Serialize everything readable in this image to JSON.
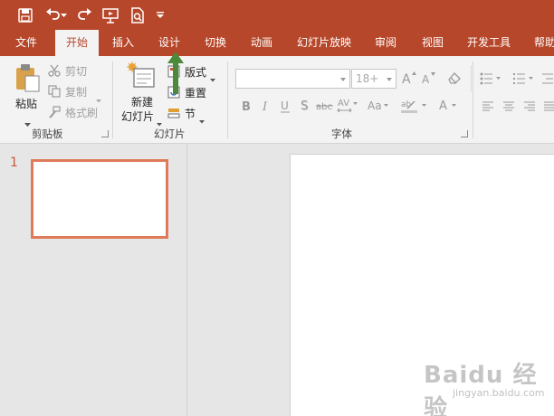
{
  "qat": {
    "items": [
      {
        "icon": "save-icon"
      },
      {
        "icon": "undo-icon"
      },
      {
        "icon": "redo-icon"
      },
      {
        "icon": "start-from-beginning-icon"
      },
      {
        "icon": "print-preview-icon"
      },
      {
        "icon": "customize-dropdown-icon"
      }
    ]
  },
  "tabs": [
    {
      "label": "文件"
    },
    {
      "label": "开始",
      "active": true
    },
    {
      "label": "插入"
    },
    {
      "label": "设计"
    },
    {
      "label": "切换"
    },
    {
      "label": "动画"
    },
    {
      "label": "幻灯片放映"
    },
    {
      "label": "审阅"
    },
    {
      "label": "视图"
    },
    {
      "label": "开发工具"
    },
    {
      "label": "帮助"
    }
  ],
  "clipboard": {
    "paste": "粘贴",
    "cut": "剪切",
    "copy": "复制",
    "format_painter": "格式刷",
    "group_label": "剪贴板"
  },
  "slides": {
    "new_slide_line1": "新建",
    "new_slide_line2": "幻灯片",
    "layout": "版式",
    "reset": "重置",
    "section": "节",
    "group_label": "幻灯片"
  },
  "font": {
    "name_value": "",
    "size_value": "18+",
    "group_label": "字体"
  },
  "thumbnail": {
    "number": "1"
  },
  "watermark": {
    "text": "Baidu 经验",
    "sub": "jingyan.baidu.com"
  },
  "colors": {
    "accent": "#b7472a",
    "arrow": "#4a8a3a",
    "thumb_border": "#e07b5a"
  }
}
